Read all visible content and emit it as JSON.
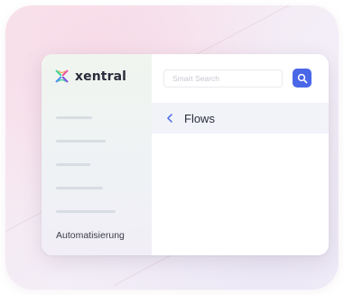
{
  "app": {
    "brand_name": "xentral"
  },
  "search": {
    "placeholder": "Smart Search",
    "icon": "search-icon"
  },
  "sidebar": {
    "active_item_label": "Automatisierung"
  },
  "main": {
    "page_title": "Flows",
    "back_icon": "chevron-left-icon"
  },
  "colors": {
    "accent": "#4a67e8",
    "logo_green": "#3dd598",
    "logo_pink": "#f0509e",
    "logo_purple": "#7b4fe0",
    "logo_blue": "#4a8ef0"
  }
}
